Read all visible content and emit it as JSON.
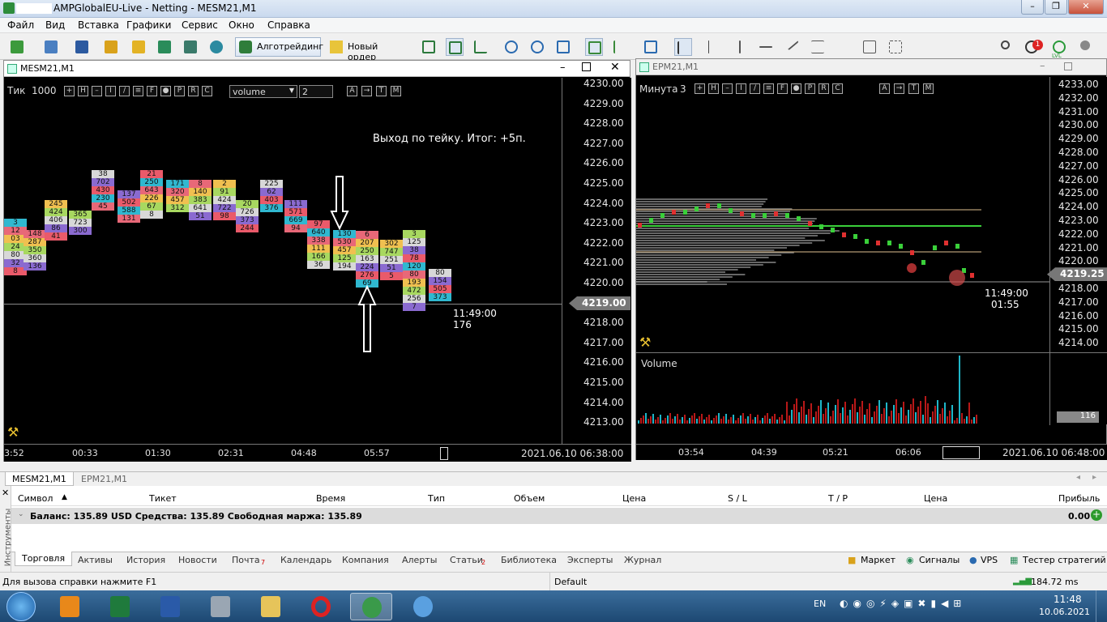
{
  "window": {
    "title": "AMPGlobalEU-Live - Netting - MESM21,M1"
  },
  "menu": [
    "Файл",
    "Вид",
    "Вставка",
    "Графики",
    "Сервис",
    "Окно",
    "Справка"
  ],
  "toolbar": {
    "algo_label": "Алготрейдинг",
    "order_label": "Новый ордер",
    "notif_count": "1",
    "lvl_label": "LVL"
  },
  "chart1": {
    "title": "MESM21,M1",
    "overlay": {
      "period_label": "Тик",
      "period_value": "1000",
      "indicator": "volume",
      "value": "2"
    },
    "annotation": "Выход по тейку. Итог: +5п.",
    "prices": [
      "4230.00",
      "4229.00",
      "4228.00",
      "4227.00",
      "4226.00",
      "4225.00",
      "4224.00",
      "4223.00",
      "4222.00",
      "4221.00",
      "4220.00",
      "4219.00",
      "4218.00",
      "4217.00",
      "4216.00",
      "4215.00",
      "4214.00",
      "4213.00"
    ],
    "current_price": "4219.00",
    "time_label": "11:49:00",
    "count_label": "176",
    "time_axis": [
      "3:52",
      "00:33",
      "01:30",
      "02:31",
      "04:48",
      "05:57"
    ],
    "date_label": "2021.06.10 06:38:00",
    "candles": [
      [
        "3",
        "12",
        "03",
        "24",
        "80",
        "32",
        "8"
      ],
      [
        "148",
        "287",
        "350",
        "360",
        "136"
      ],
      [
        "245",
        "424",
        "406",
        "86",
        "41"
      ],
      [
        "365",
        "723",
        "300"
      ],
      [
        "38",
        "702",
        "430",
        "230",
        "45"
      ],
      [
        "137",
        "502",
        "588",
        "131"
      ],
      [
        "21",
        "250",
        "643",
        "226",
        "67",
        "8"
      ],
      [
        "171",
        "320",
        "457",
        "312"
      ],
      [
        "8",
        "140",
        "383",
        "641",
        "51"
      ],
      [
        "2",
        "91",
        "424",
        "722",
        "98"
      ],
      [
        "20",
        "726",
        "373",
        "244"
      ],
      [
        "225",
        "62",
        "403",
        "376"
      ],
      [
        "111",
        "571",
        "669",
        "94"
      ],
      [
        "97",
        "640",
        "338",
        "111",
        "166",
        "36"
      ],
      [
        "130",
        "530",
        "457",
        "125",
        "194"
      ],
      [
        "6",
        "207",
        "250",
        "163",
        "224",
        "276",
        "69"
      ],
      [
        "302",
        "747",
        "251",
        "51",
        "5"
      ],
      [
        "3",
        "125",
        "38",
        "78",
        "120",
        "80",
        "193",
        "472",
        "256",
        "7"
      ],
      [
        "80",
        "154",
        "505",
        "373"
      ]
    ]
  },
  "chart2": {
    "title": "EPM21,M1",
    "overlay": {
      "period_label": "Минута",
      "period_value": "3"
    },
    "prices": [
      "4233.00",
      "4232.00",
      "4231.00",
      "4230.00",
      "4229.00",
      "4228.00",
      "4227.00",
      "4226.00",
      "4225.00",
      "4224.00",
      "4223.00",
      "4222.00",
      "4221.00",
      "4220.00",
      "4219.25",
      "4218.00",
      "4217.00",
      "4216.00",
      "4215.00",
      "4214.00"
    ],
    "current_price": "4219.25",
    "time_label": "11:49:00",
    "countdown": "01:55",
    "volume_label": "Volume",
    "volume_value": "116",
    "time_axis": [
      "03:54",
      "04:39",
      "05:21",
      "06:06"
    ],
    "date_label": "2021.06.10 06:48:00"
  },
  "chart_tabs": [
    "MESM21,M1",
    "EPM21,M1"
  ],
  "terminal": {
    "headers": [
      "Символ",
      "Тикет",
      "Время",
      "Тип",
      "Объем",
      "Цена",
      "S / L",
      "T / P",
      "Цена",
      "Прибыль"
    ],
    "balance_line": "Баланс: 135.89 USD  Средства: 135.89  Свободная маржа: 135.89",
    "profit": "0.00",
    "side_label": "Инструменты",
    "tabs": [
      "Торговля",
      "Активы",
      "История",
      "Новости",
      "Почта",
      "Календарь",
      "Компания",
      "Алерты",
      "Статьи",
      "Библиотека",
      "Эксперты",
      "Журнал"
    ],
    "mail_badge": "7",
    "articles_badge": "2",
    "right_links": [
      "Маркет",
      "Сигналы",
      "VPS",
      "Тестер стратегий"
    ]
  },
  "status": {
    "help": "Для вызова справки нажмите F1",
    "profile": "Default",
    "ping": "184.72 ms"
  },
  "taskbar": {
    "lang": "EN",
    "time": "11:48",
    "date": "10.06.2021"
  }
}
